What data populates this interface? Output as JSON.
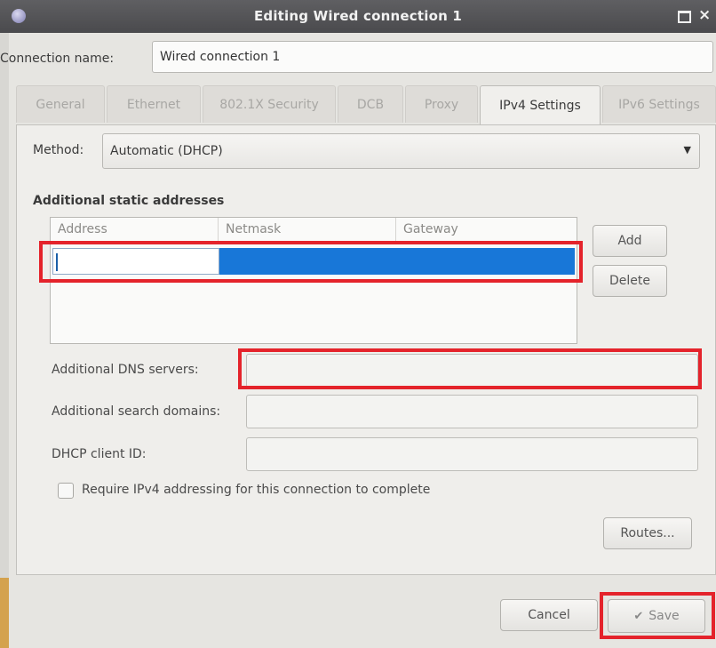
{
  "window": {
    "title": "Editing Wired connection 1",
    "controls": {
      "maximize": "maximize-icon",
      "close": "×"
    }
  },
  "connection_name": {
    "label": "Connection name:",
    "value": "Wired connection 1"
  },
  "tabs": [
    {
      "label": "General",
      "active": false
    },
    {
      "label": "Ethernet",
      "active": false
    },
    {
      "label": "802.1X Security",
      "active": false
    },
    {
      "label": "DCB",
      "active": false
    },
    {
      "label": "Proxy",
      "active": false
    },
    {
      "label": "IPv4 Settings",
      "active": true
    },
    {
      "label": "IPv6 Settings",
      "active": false
    }
  ],
  "ipv4": {
    "method_label": "Method:",
    "method_value": "Automatic (DHCP)",
    "addresses_heading": "Additional static addresses",
    "columns": [
      "Address",
      "Netmask",
      "Gateway"
    ],
    "rows": [
      {
        "address": "",
        "netmask": "",
        "gateway": "",
        "selected": true
      }
    ],
    "add_label": "Add",
    "delete_label": "Delete",
    "dns_label": "Additional DNS servers:",
    "dns_value": "",
    "search_label": "Additional search domains:",
    "search_value": "",
    "dhcp_label": "DHCP client ID:",
    "dhcp_value": "",
    "require_label": "Require IPv4 addressing for this connection to complete",
    "require_checked": false,
    "routes_label": "Routes..."
  },
  "footer": {
    "cancel_label": "Cancel",
    "save_label": "Save",
    "save_icon": "checkmark-icon"
  },
  "colors": {
    "selection": "#1877d8",
    "annotation": "#e4232b",
    "titlebar": "#4f4f52"
  }
}
